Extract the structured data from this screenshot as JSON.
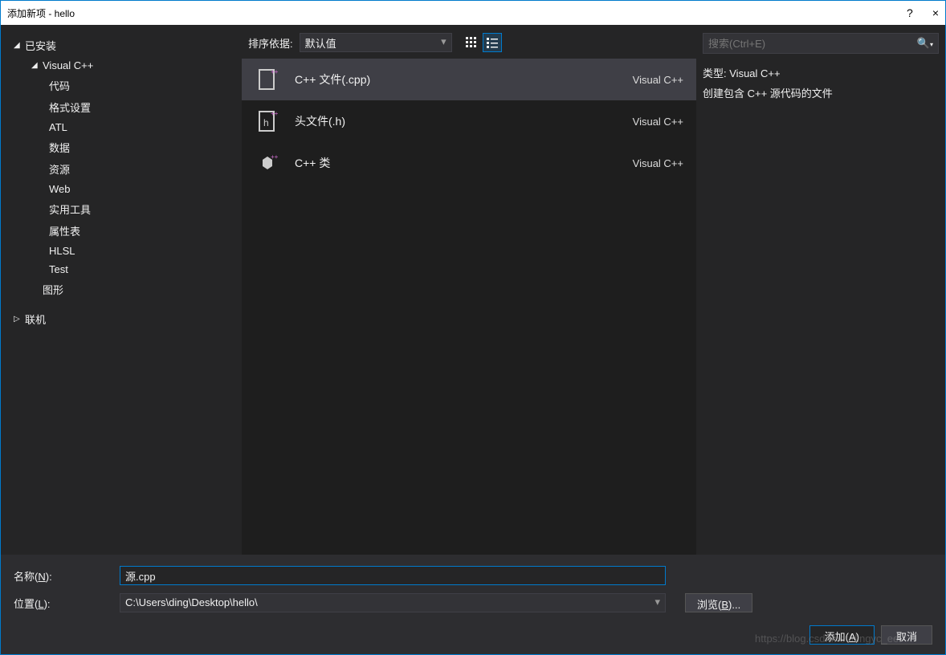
{
  "window": {
    "title": "添加新项 - hello",
    "help": "?",
    "close": "×"
  },
  "sidebar": {
    "installed": "已安装",
    "visual_cpp": "Visual C++",
    "items": {
      "code": "代码",
      "format": "格式设置",
      "atl": "ATL",
      "data": "数据",
      "resource": "资源",
      "web": "Web",
      "utility": "实用工具",
      "propsheet": "属性表",
      "hlsl": "HLSL",
      "test": "Test"
    },
    "graphics": "图形",
    "online": "联机"
  },
  "header": {
    "sort_label": "排序依据:",
    "sort_value": "默认值"
  },
  "templates": [
    {
      "name": "C++ 文件(.cpp)",
      "lang": "Visual C++",
      "selected": true
    },
    {
      "name": "头文件(.h)",
      "lang": "Visual C++",
      "selected": false
    },
    {
      "name": "C++ 类",
      "lang": "Visual C++",
      "selected": false
    }
  ],
  "right": {
    "search_placeholder": "搜索(Ctrl+E)",
    "type_label": "类型:",
    "type_value": "Visual C++",
    "description": "创建包含 C++ 源代码的文件"
  },
  "form": {
    "name_label": "名称(N):",
    "name_value": "源.cpp",
    "location_label": "位置(L):",
    "location_value": "C:\\Users\\ding\\Desktop\\hello\\",
    "browse": "浏览(B)..."
  },
  "buttons": {
    "add": "添加(A)",
    "cancel": "取消"
  },
  "watermark": "https://blog.csdn.net/dingyc_ee"
}
